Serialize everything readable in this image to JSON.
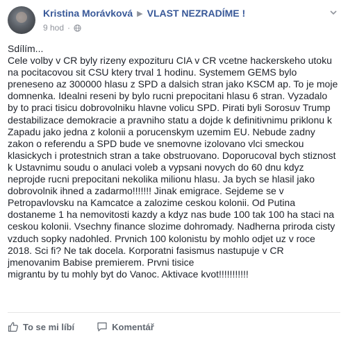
{
  "post": {
    "author": "Kristina Morávková",
    "group": "VLAST NEZRADÍME !",
    "time": "9 hod",
    "text": "Sdílím...\nCele volby v CR byly rizeny expozituru CIA v CR vcetne hackerskeho utoku\nna pocitacovou sit CSU ktery trval 1 hodinu. Systemem GEMS bylo\npreneseno az 300000 hlasu z SPD a dalsich stran jako KSCM ap. To je moje\ndomnenka. Idealni reseni by bylo rucni prepocitani hlasu 6 stran. Vyzadalo\nby to praci tisicu dobrovolniku hlavne volicu SPD. Pirati byli Sorosuv Trump\ndestabilizace demokracie a pravniho statu a dojde k definitivnimu priklonu k\nZapadu jako jedna z kolonii a porucenskym uzemim EU. Nebude zadny\nzakon o referendu a SPD bude ve snemovne izolovano vlci smeckou\nklasickych i protestnich stran a take obstruovano. Doporucoval bych stiznost\nk Ustavnimu soudu o anulaci voleb a vypsani novych do 60 dnu kdyz\nneprojde rucni prepocitani nekolika milionu hlasu. Ja bych se hlasil jako\ndobrovolnik ihned a zadarmo!!!!!!! Jinak emigrace. Sejdeme se v\nPetropavlovsku na Kamcatce a zalozime ceskou kolonii. Od Putina\ndostaneme 1 ha nemovitosti kazdy a kdyz nas bude 100 tak 100 ha staci na\nceskou kolonii. Vsechny finance slozime dohromady. Nadherna priroda cisty\nvzduch sopky nadohled. Prvnich 100 kolonistu by mohlo odjet uz v roce\n2018. Sci fi? Ne tak docela. Korporatni fasismus nastupuje v CR\njmenovanim Babise premierem. Prvni tisice\nmigrantu by tu mohly byt do Vanoc. Aktivace kvot!!!!!!!!!!!"
  },
  "actions": {
    "like": "To se mi líbí",
    "comment": "Komentář"
  },
  "icons": {
    "arrow": "right-triangle-icon",
    "audience": "globe-icon",
    "menu": "chevron-down-icon",
    "like": "thumbs-up-icon",
    "comment": "speech-bubble-icon"
  },
  "colors": {
    "link": "#385898",
    "meta": "#90949c",
    "text": "#1d2129",
    "action": "#606770"
  }
}
